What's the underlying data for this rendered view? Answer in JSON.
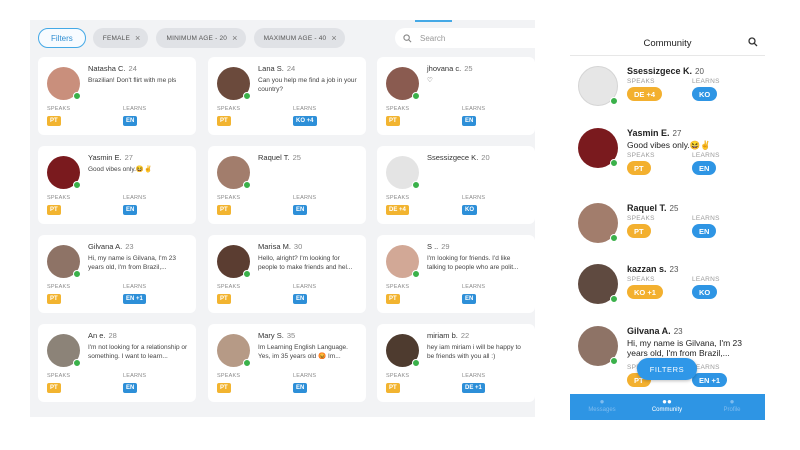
{
  "desktop": {
    "filter_button": "Filters",
    "chips": [
      {
        "label": "FEMALE"
      },
      {
        "label": "MINIMUM AGE - 20"
      },
      {
        "label": "MAXIMUM AGE - 40"
      }
    ],
    "chip_close": "×",
    "search_placeholder": "Search",
    "speaks_label": "SPEAKS",
    "learns_label": "LEARNS",
    "cards": [
      {
        "name": "Natasha C.",
        "age": "24",
        "bio": "Brazilian! Don't flirt with me pls",
        "speaks": "PT",
        "learns": "EN",
        "avatar": "#c98f7c"
      },
      {
        "name": "Lana S.",
        "age": "24",
        "bio": "Can you help me find a job in your country?",
        "speaks": "PT",
        "learns": "KO +4",
        "avatar": "#6b4a3c"
      },
      {
        "name": "jhovana c.",
        "age": "25",
        "bio": "♡",
        "speaks": "PT",
        "learns": "EN",
        "avatar": "#8a5b50"
      },
      {
        "name": "Yasmin E.",
        "age": "27",
        "bio": "Good vibes only.😆✌",
        "speaks": "PT",
        "learns": "EN",
        "avatar": "#7a1a1e"
      },
      {
        "name": "Raquel T.",
        "age": "25",
        "bio": "",
        "speaks": "PT",
        "learns": "EN",
        "avatar": "#a27d6c"
      },
      {
        "name": "Ssessizgece K.",
        "age": "20",
        "bio": "",
        "speaks": "DE +4",
        "learns": "KO",
        "avatar": "#e4e4e4"
      },
      {
        "name": "Gilvana A.",
        "age": "23",
        "bio": "Hi, my name is Gilvana, I'm 23 years old, I'm from Brazil,...",
        "speaks": "PT",
        "learns": "EN +1",
        "avatar": "#8e7366"
      },
      {
        "name": "Marisa M.",
        "age": "30",
        "bio": "Hello, alright? I'm looking for people to make friends and hel...",
        "speaks": "PT",
        "learns": "EN",
        "avatar": "#5b3d31"
      },
      {
        "name": "S ..",
        "age": "29",
        "bio": "I'm looking for friends. I'd like talking to people who are polit...",
        "speaks": "PT",
        "learns": "EN",
        "avatar": "#d2a896"
      },
      {
        "name": "An e.",
        "age": "28",
        "bio": "I'm not looking for a relationship or something. I want to learn...",
        "speaks": "PT",
        "learns": "EN",
        "avatar": "#8c8378"
      },
      {
        "name": "Mary S.",
        "age": "35",
        "bio": "Im Learning English Language. Yes, im 35 years old 😡 Im...",
        "speaks": "PT",
        "learns": "EN",
        "avatar": "#b69a86"
      },
      {
        "name": "miriam b.",
        "age": "22",
        "bio": "hey iam miriam i will be happy to be friends with you all :)",
        "speaks": "PT",
        "learns": "DE +1",
        "avatar": "#4e3b2f"
      }
    ]
  },
  "mobile": {
    "title": "Community",
    "speaks_label": "SPEAKS",
    "learns_label": "LEARNS",
    "rows": [
      {
        "name": "Ssessizgece K.",
        "age": "20",
        "bio": "",
        "speaks": "DE +4",
        "learns": "KO",
        "avatar": "#e6e6e6"
      },
      {
        "name": "Yasmin E.",
        "age": "27",
        "bio": "Good vibes only.😆✌",
        "speaks": "PT",
        "learns": "EN",
        "avatar": "#7a1a1e"
      },
      {
        "name": "Raquel T.",
        "age": "25",
        "bio": "",
        "speaks": "PT",
        "learns": "EN",
        "avatar": "#a27d6c"
      },
      {
        "name": "kazzan s.",
        "age": "23",
        "bio": "",
        "speaks": "KO +1",
        "learns": "KO",
        "avatar": "#5f4a40"
      },
      {
        "name": "Gilvana A.",
        "age": "23",
        "bio": "Hi, my name is Gilvana, I'm 23 years old, I'm from Brazil,...",
        "speaks": "PT",
        "learns": "EN +1",
        "avatar": "#8e7366"
      }
    ],
    "fab_label": "FILTERS",
    "tabs": [
      {
        "label": "Messages",
        "icon": "chat-icon"
      },
      {
        "label": "Community",
        "icon": "people-icon"
      },
      {
        "label": "Profile",
        "icon": "person-icon"
      }
    ]
  },
  "colors": {
    "accent": "#2e95e4",
    "speaks_tag": "#f2b430",
    "online": "#3ab14a"
  }
}
